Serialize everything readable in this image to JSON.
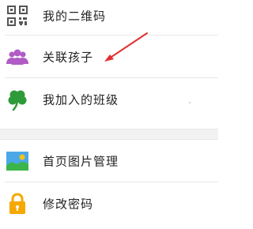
{
  "menu": {
    "group1": [
      {
        "label": "我的二维码",
        "icon": "qr-code-icon"
      },
      {
        "label": "关联孩子",
        "icon": "people-icon"
      },
      {
        "label": "我加入的班级",
        "icon": "clover-icon"
      }
    ],
    "group2": [
      {
        "label": "首页图片管理",
        "icon": "image-icon"
      },
      {
        "label": "修改密码",
        "icon": "lock-icon"
      }
    ]
  },
  "colors": {
    "people_icon": "#b05cc4",
    "clover_icon": "#2e9b3a",
    "image_sky": "#4aa8e8",
    "image_hill": "#3bb54a",
    "image_sun": "#f5c11a",
    "lock_icon": "#f5a800",
    "annotation_arrow": "#e23030"
  }
}
